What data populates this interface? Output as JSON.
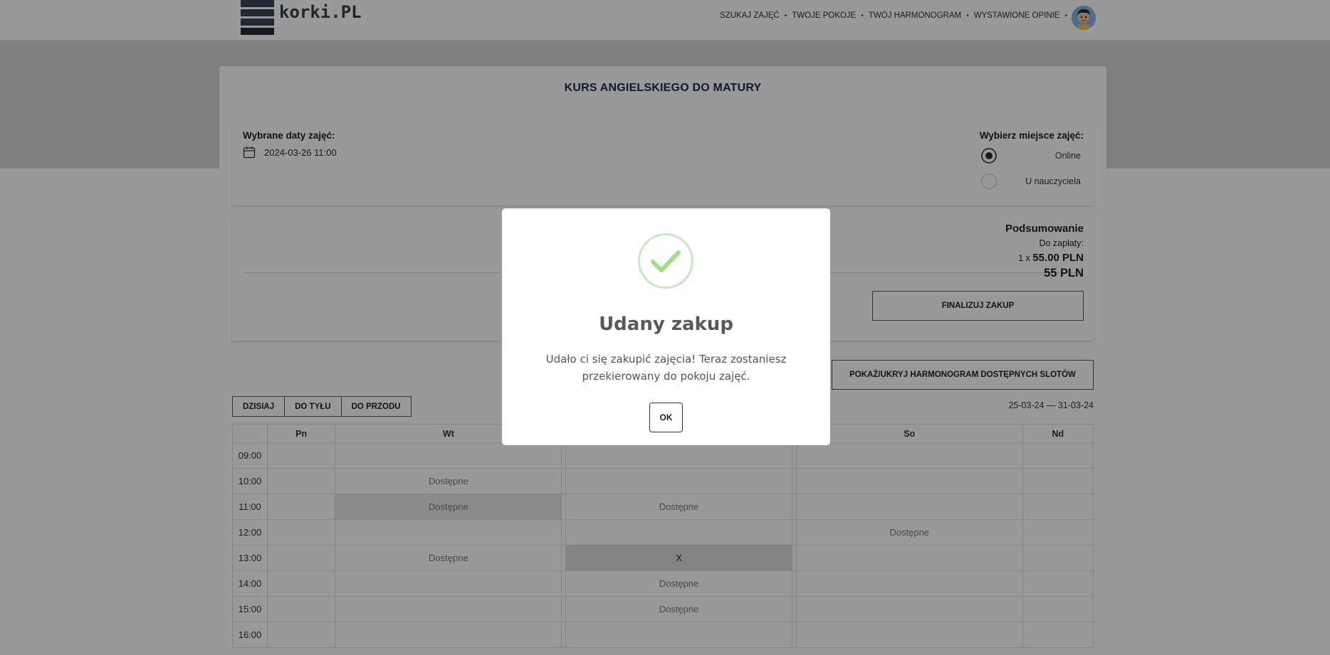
{
  "header": {
    "logo_text": "korki.PL",
    "nav": [
      "SZUKAJ ZAJĘĆ",
      "TWOJE POKOJE",
      "TWÓJ HARMONOGRAM",
      "WYSTAWIONE OPINIE"
    ],
    "separator": "•"
  },
  "course": {
    "title": "KURS ANGIELSKIEGO DO MATURY"
  },
  "dates": {
    "label": "Wybrane daty zajęć:",
    "value": "2024-03-26 11:00"
  },
  "location": {
    "label": "Wybierz miejsce zajęć:",
    "options": [
      {
        "label": "Online",
        "checked": true
      },
      {
        "label": "U nauczyciela",
        "checked": false
      }
    ]
  },
  "summary": {
    "title": "Podsumowanie",
    "due_label": "Do zapłaty:",
    "qty_prefix": "1 x",
    "unit_price": "55.00 PLN",
    "total": "55 PLN",
    "finalize_label": "FINALIZUJ ZAKUP"
  },
  "schedule": {
    "toggle_label": "POKAŻ/UKRYJ HARMONOGRAM DOSTĘPNYCH SLOTÓW",
    "nav": [
      "DZISIAJ",
      "DO TYŁU",
      "DO PRZODU"
    ],
    "range": "25-03-24 — 31-03-24",
    "days": [
      "Pn",
      "Wt",
      "",
      "",
      "",
      "So",
      "Nd"
    ],
    "rows": [
      {
        "time": "09:00",
        "cells": [
          "",
          "",
          "",
          "",
          "",
          "",
          ""
        ]
      },
      {
        "time": "10:00",
        "cells": [
          "",
          "Dostępne",
          "",
          "",
          "",
          "",
          ""
        ]
      },
      {
        "time": "11:00",
        "cells": [
          "",
          "Dostępne",
          "",
          "Dostępne",
          "",
          "",
          ""
        ]
      },
      {
        "time": "12:00",
        "cells": [
          "",
          "",
          "",
          "",
          "",
          "Dostępne",
          ""
        ]
      },
      {
        "time": "13:00",
        "cells": [
          "",
          "Dostępne",
          "",
          "X",
          "",
          "",
          ""
        ]
      },
      {
        "time": "14:00",
        "cells": [
          "",
          "",
          "",
          "Dostępne",
          "",
          "",
          ""
        ]
      },
      {
        "time": "15:00",
        "cells": [
          "",
          "",
          "",
          "Dostępne",
          "",
          "",
          ""
        ]
      },
      {
        "time": "16:00",
        "cells": [
          "",
          "",
          "",
          "",
          "",
          "",
          ""
        ]
      }
    ]
  },
  "modal": {
    "icon": "success-check-icon",
    "title": "Udany zakup",
    "message": "Udało ci się zakupić zajęcia! Teraz zostaniesz przekierowany do pokoju zajęć.",
    "ok_label": "OK"
  },
  "colors": {
    "check": "#a5dc86",
    "check_ring": "#c8e7c3",
    "overlay": "rgba(0,0,0,0.4)"
  }
}
